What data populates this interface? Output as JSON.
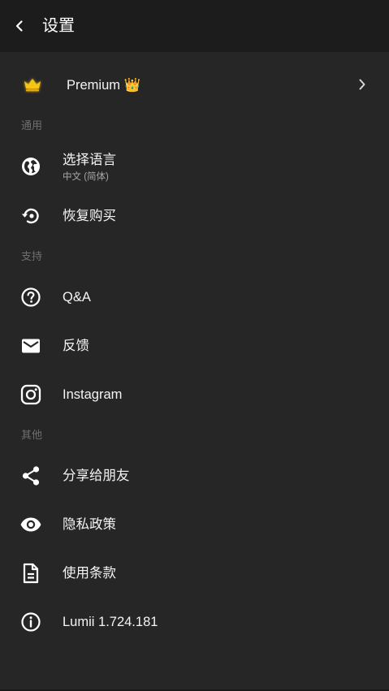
{
  "header": {
    "title": "设置",
    "back_icon": "back-arrow-icon"
  },
  "premium": {
    "label": "Premium 👑",
    "icon": "crown-icon",
    "accent": "#F5C518"
  },
  "sections": {
    "general": "通用",
    "support": "支持",
    "other": "其他"
  },
  "items": {
    "language": {
      "label": "选择语言",
      "value": "中文 (简体)",
      "icon": "globe-icon"
    },
    "restore": {
      "label": "恢复购买",
      "icon": "restore-icon"
    },
    "qa": {
      "label": "Q&A",
      "icon": "help-circle-icon"
    },
    "feedback": {
      "label": "反馈",
      "icon": "mail-icon"
    },
    "instagram": {
      "label": "Instagram",
      "icon": "instagram-icon"
    },
    "share": {
      "label": "分享给朋友",
      "icon": "share-icon"
    },
    "privacy": {
      "label": "隐私政策",
      "icon": "eye-icon"
    },
    "terms": {
      "label": "使用条款",
      "icon": "document-icon"
    },
    "version": {
      "label": "Lumii 1.724.181",
      "icon": "info-icon"
    }
  }
}
